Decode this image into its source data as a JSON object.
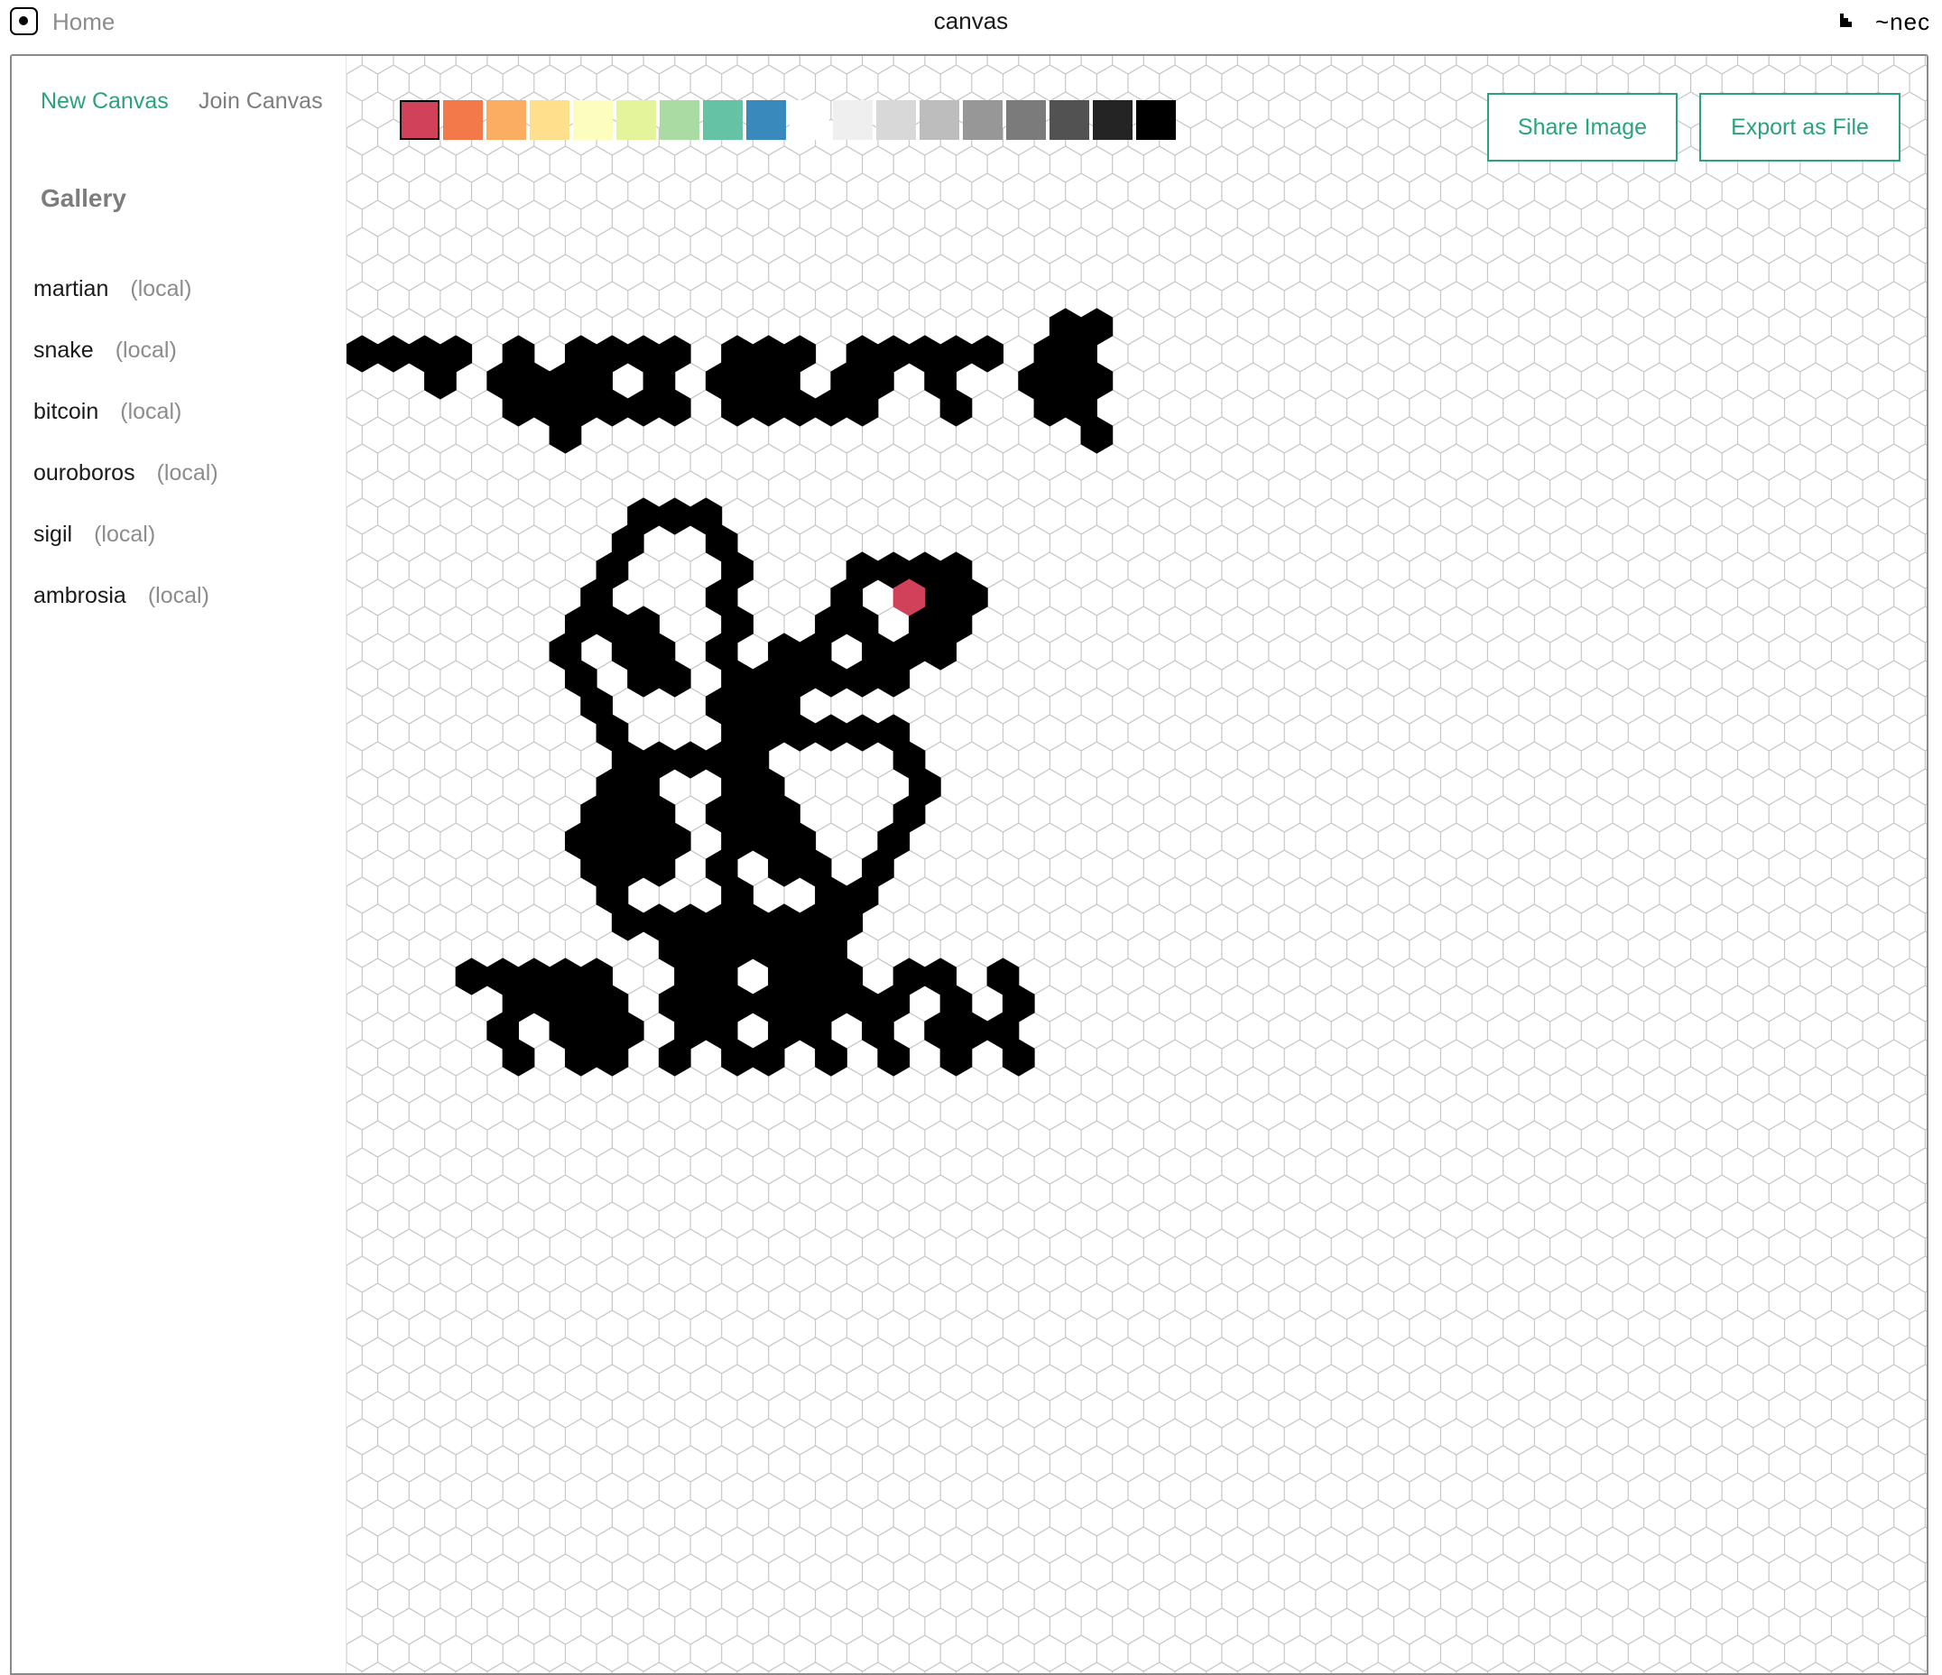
{
  "topbar": {
    "home_label": "Home",
    "window_title": "canvas",
    "ship_name": "~nec"
  },
  "sidebar": {
    "nav": {
      "new_canvas": "New Canvas",
      "join_canvas": "Join Canvas"
    },
    "gallery_title": "Gallery",
    "gallery": [
      {
        "name": "martian",
        "tag": "(local)"
      },
      {
        "name": "snake",
        "tag": "(local)"
      },
      {
        "name": "bitcoin",
        "tag": "(local)"
      },
      {
        "name": "ouroboros",
        "tag": "(local)"
      },
      {
        "name": "sigil",
        "tag": "(local)"
      },
      {
        "name": "ambrosia",
        "tag": "(local)"
      }
    ]
  },
  "palette": {
    "selected_index": 0,
    "swatches": [
      "#d1425a",
      "#f3784a",
      "#fbae62",
      "#fedf8b",
      "#fdfebd",
      "#e3f49b",
      "#a9dba3",
      "#65c2a5",
      "#3a89bc",
      "#ffffff",
      "#efefef",
      "#d8d8d8",
      "#bdbdbd",
      "#979797",
      "#7b7b7b",
      "#525252",
      "#242424",
      "#000000"
    ]
  },
  "actions": {
    "share_label": "Share Image",
    "export_label": "Export as File"
  },
  "colors": {
    "accent": "#2aa37a",
    "grid_line": "#c7c7c7",
    "ink": "#000000",
    "eye": "#d1425a"
  },
  "canvas_art": {
    "top_text": "~NORSYR",
    "bottom_text": "TORRYN",
    "description_icon": "butterfly-sigil"
  }
}
